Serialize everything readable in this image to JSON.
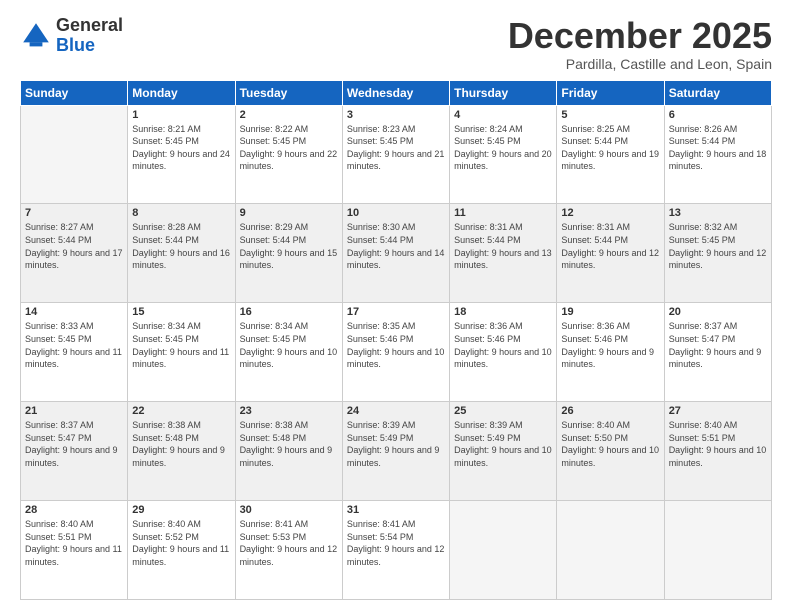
{
  "header": {
    "logo_general": "General",
    "logo_blue": "Blue",
    "month_title": "December 2025",
    "location": "Pardilla, Castille and Leon, Spain"
  },
  "weekdays": [
    "Sunday",
    "Monday",
    "Tuesday",
    "Wednesday",
    "Thursday",
    "Friday",
    "Saturday"
  ],
  "weeks": [
    [
      {
        "day": "",
        "sunrise": "",
        "sunset": "",
        "daylight": ""
      },
      {
        "day": "1",
        "sunrise": "Sunrise: 8:21 AM",
        "sunset": "Sunset: 5:45 PM",
        "daylight": "Daylight: 9 hours and 24 minutes."
      },
      {
        "day": "2",
        "sunrise": "Sunrise: 8:22 AM",
        "sunset": "Sunset: 5:45 PM",
        "daylight": "Daylight: 9 hours and 22 minutes."
      },
      {
        "day": "3",
        "sunrise": "Sunrise: 8:23 AM",
        "sunset": "Sunset: 5:45 PM",
        "daylight": "Daylight: 9 hours and 21 minutes."
      },
      {
        "day": "4",
        "sunrise": "Sunrise: 8:24 AM",
        "sunset": "Sunset: 5:45 PM",
        "daylight": "Daylight: 9 hours and 20 minutes."
      },
      {
        "day": "5",
        "sunrise": "Sunrise: 8:25 AM",
        "sunset": "Sunset: 5:44 PM",
        "daylight": "Daylight: 9 hours and 19 minutes."
      },
      {
        "day": "6",
        "sunrise": "Sunrise: 8:26 AM",
        "sunset": "Sunset: 5:44 PM",
        "daylight": "Daylight: 9 hours and 18 minutes."
      }
    ],
    [
      {
        "day": "7",
        "sunrise": "Sunrise: 8:27 AM",
        "sunset": "Sunset: 5:44 PM",
        "daylight": "Daylight: 9 hours and 17 minutes."
      },
      {
        "day": "8",
        "sunrise": "Sunrise: 8:28 AM",
        "sunset": "Sunset: 5:44 PM",
        "daylight": "Daylight: 9 hours and 16 minutes."
      },
      {
        "day": "9",
        "sunrise": "Sunrise: 8:29 AM",
        "sunset": "Sunset: 5:44 PM",
        "daylight": "Daylight: 9 hours and 15 minutes."
      },
      {
        "day": "10",
        "sunrise": "Sunrise: 8:30 AM",
        "sunset": "Sunset: 5:44 PM",
        "daylight": "Daylight: 9 hours and 14 minutes."
      },
      {
        "day": "11",
        "sunrise": "Sunrise: 8:31 AM",
        "sunset": "Sunset: 5:44 PM",
        "daylight": "Daylight: 9 hours and 13 minutes."
      },
      {
        "day": "12",
        "sunrise": "Sunrise: 8:31 AM",
        "sunset": "Sunset: 5:44 PM",
        "daylight": "Daylight: 9 hours and 12 minutes."
      },
      {
        "day": "13",
        "sunrise": "Sunrise: 8:32 AM",
        "sunset": "Sunset: 5:45 PM",
        "daylight": "Daylight: 9 hours and 12 minutes."
      }
    ],
    [
      {
        "day": "14",
        "sunrise": "Sunrise: 8:33 AM",
        "sunset": "Sunset: 5:45 PM",
        "daylight": "Daylight: 9 hours and 11 minutes."
      },
      {
        "day": "15",
        "sunrise": "Sunrise: 8:34 AM",
        "sunset": "Sunset: 5:45 PM",
        "daylight": "Daylight: 9 hours and 11 minutes."
      },
      {
        "day": "16",
        "sunrise": "Sunrise: 8:34 AM",
        "sunset": "Sunset: 5:45 PM",
        "daylight": "Daylight: 9 hours and 10 minutes."
      },
      {
        "day": "17",
        "sunrise": "Sunrise: 8:35 AM",
        "sunset": "Sunset: 5:46 PM",
        "daylight": "Daylight: 9 hours and 10 minutes."
      },
      {
        "day": "18",
        "sunrise": "Sunrise: 8:36 AM",
        "sunset": "Sunset: 5:46 PM",
        "daylight": "Daylight: 9 hours and 10 minutes."
      },
      {
        "day": "19",
        "sunrise": "Sunrise: 8:36 AM",
        "sunset": "Sunset: 5:46 PM",
        "daylight": "Daylight: 9 hours and 9 minutes."
      },
      {
        "day": "20",
        "sunrise": "Sunrise: 8:37 AM",
        "sunset": "Sunset: 5:47 PM",
        "daylight": "Daylight: 9 hours and 9 minutes."
      }
    ],
    [
      {
        "day": "21",
        "sunrise": "Sunrise: 8:37 AM",
        "sunset": "Sunset: 5:47 PM",
        "daylight": "Daylight: 9 hours and 9 minutes."
      },
      {
        "day": "22",
        "sunrise": "Sunrise: 8:38 AM",
        "sunset": "Sunset: 5:48 PM",
        "daylight": "Daylight: 9 hours and 9 minutes."
      },
      {
        "day": "23",
        "sunrise": "Sunrise: 8:38 AM",
        "sunset": "Sunset: 5:48 PM",
        "daylight": "Daylight: 9 hours and 9 minutes."
      },
      {
        "day": "24",
        "sunrise": "Sunrise: 8:39 AM",
        "sunset": "Sunset: 5:49 PM",
        "daylight": "Daylight: 9 hours and 9 minutes."
      },
      {
        "day": "25",
        "sunrise": "Sunrise: 8:39 AM",
        "sunset": "Sunset: 5:49 PM",
        "daylight": "Daylight: 9 hours and 10 minutes."
      },
      {
        "day": "26",
        "sunrise": "Sunrise: 8:40 AM",
        "sunset": "Sunset: 5:50 PM",
        "daylight": "Daylight: 9 hours and 10 minutes."
      },
      {
        "day": "27",
        "sunrise": "Sunrise: 8:40 AM",
        "sunset": "Sunset: 5:51 PM",
        "daylight": "Daylight: 9 hours and 10 minutes."
      }
    ],
    [
      {
        "day": "28",
        "sunrise": "Sunrise: 8:40 AM",
        "sunset": "Sunset: 5:51 PM",
        "daylight": "Daylight: 9 hours and 11 minutes."
      },
      {
        "day": "29",
        "sunrise": "Sunrise: 8:40 AM",
        "sunset": "Sunset: 5:52 PM",
        "daylight": "Daylight: 9 hours and 11 minutes."
      },
      {
        "day": "30",
        "sunrise": "Sunrise: 8:41 AM",
        "sunset": "Sunset: 5:53 PM",
        "daylight": "Daylight: 9 hours and 12 minutes."
      },
      {
        "day": "31",
        "sunrise": "Sunrise: 8:41 AM",
        "sunset": "Sunset: 5:54 PM",
        "daylight": "Daylight: 9 hours and 12 minutes."
      },
      {
        "day": "",
        "sunrise": "",
        "sunset": "",
        "daylight": ""
      },
      {
        "day": "",
        "sunrise": "",
        "sunset": "",
        "daylight": ""
      },
      {
        "day": "",
        "sunrise": "",
        "sunset": "",
        "daylight": ""
      }
    ]
  ]
}
